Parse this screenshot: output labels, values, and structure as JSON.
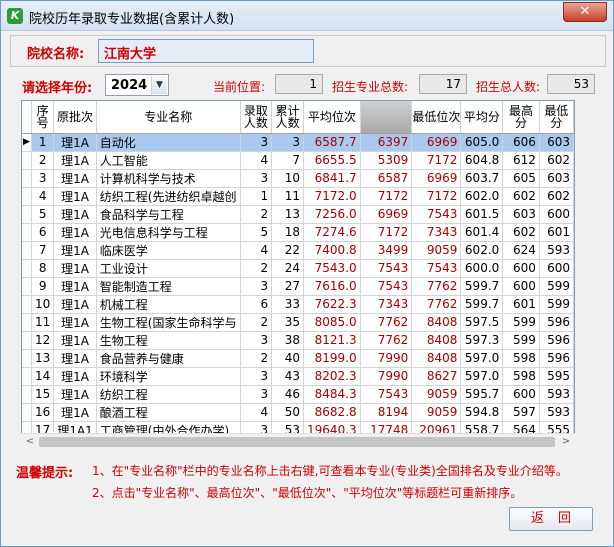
{
  "window": {
    "title": "院校历年录取专业数据(含累计人数)",
    "close_glyph": "✕",
    "icon_glyph": "K"
  },
  "school": {
    "label": "院校名称:",
    "value": "江南大学"
  },
  "year": {
    "label": "请选择年份:",
    "selected": "2024",
    "arrow_glyph": "▼"
  },
  "stats": {
    "current_pos_label": "当前位置:",
    "current_pos_value": "1",
    "total_majors_label": "招生专业总数:",
    "total_majors_value": "17",
    "total_people_label": "招生总人数:",
    "total_people_value": "53"
  },
  "table": {
    "headers": [
      "序号",
      "原批次",
      "专业名称",
      "录取人数",
      "累计人数",
      "平均位次",
      "",
      "最低位次",
      "平均分",
      "最高分",
      "最低分"
    ],
    "selected_row_marker": "▶",
    "rows": [
      [
        "1",
        "理1A",
        "自动化",
        "3",
        "3",
        "6587.7",
        "6397",
        "6969",
        "605.0",
        "606",
        "603"
      ],
      [
        "2",
        "理1A",
        "人工智能",
        "4",
        "7",
        "6655.5",
        "5309",
        "7172",
        "604.8",
        "612",
        "602"
      ],
      [
        "3",
        "理1A",
        "计算机科学与技术",
        "3",
        "10",
        "6841.7",
        "6587",
        "6969",
        "603.7",
        "605",
        "603"
      ],
      [
        "4",
        "理1A",
        "纺织工程(先进纺织卓越创",
        "1",
        "11",
        "7172.0",
        "7172",
        "7172",
        "602.0",
        "602",
        "602"
      ],
      [
        "5",
        "理1A",
        "食品科学与工程",
        "2",
        "13",
        "7256.0",
        "6969",
        "7543",
        "601.5",
        "603",
        "600"
      ],
      [
        "6",
        "理1A",
        "光电信息科学与工程",
        "5",
        "18",
        "7274.6",
        "7172",
        "7343",
        "601.4",
        "602",
        "601"
      ],
      [
        "7",
        "理1A",
        "临床医学",
        "4",
        "22",
        "7400.8",
        "3499",
        "9059",
        "602.0",
        "624",
        "593"
      ],
      [
        "8",
        "理1A",
        "工业设计",
        "2",
        "24",
        "7543.0",
        "7543",
        "7543",
        "600.0",
        "600",
        "600"
      ],
      [
        "9",
        "理1A",
        "智能制造工程",
        "3",
        "27",
        "7616.0",
        "7543",
        "7762",
        "599.7",
        "600",
        "599"
      ],
      [
        "10",
        "理1A",
        "机械工程",
        "6",
        "33",
        "7622.3",
        "7343",
        "7762",
        "599.7",
        "601",
        "599"
      ],
      [
        "11",
        "理1A",
        "生物工程(国家生命科学与",
        "2",
        "35",
        "8085.0",
        "7762",
        "8408",
        "597.5",
        "599",
        "596"
      ],
      [
        "12",
        "理1A",
        "生物工程",
        "3",
        "38",
        "8121.3",
        "7762",
        "8408",
        "597.3",
        "599",
        "596"
      ],
      [
        "13",
        "理1A",
        "食品营养与健康",
        "2",
        "40",
        "8199.0",
        "7990",
        "8408",
        "597.0",
        "598",
        "596"
      ],
      [
        "14",
        "理1A",
        "环境科学",
        "3",
        "43",
        "8202.3",
        "7990",
        "8627",
        "597.0",
        "598",
        "595"
      ],
      [
        "15",
        "理1A",
        "纺织工程",
        "3",
        "46",
        "8484.3",
        "7543",
        "9059",
        "595.7",
        "600",
        "593"
      ],
      [
        "16",
        "理1A",
        "酿酒工程",
        "4",
        "50",
        "8682.8",
        "8194",
        "9059",
        "594.8",
        "597",
        "593"
      ],
      [
        "17",
        "理1A1",
        "工商管理(中外合作办学)",
        "3",
        "53",
        "19640.3",
        "17748",
        "20961",
        "558.7",
        "564",
        "555"
      ]
    ]
  },
  "scroll": {
    "left_glyph": "<",
    "right_glyph": ">"
  },
  "tips": {
    "title": "温馨提示:",
    "line1": "1、在\"专业名称\"栏中的专业名称上击右键,可查看本专业(专业类)全国排名及专业介绍等。",
    "line2": "2、点击\"专业名称\"、最高位次\"、\"最低位次\"、\"平均位次\"等标题栏可重新排序。"
  },
  "buttons": {
    "back": "返回"
  },
  "colors": {
    "accent_red": "#d10000",
    "selection": "#a9c9ef"
  }
}
